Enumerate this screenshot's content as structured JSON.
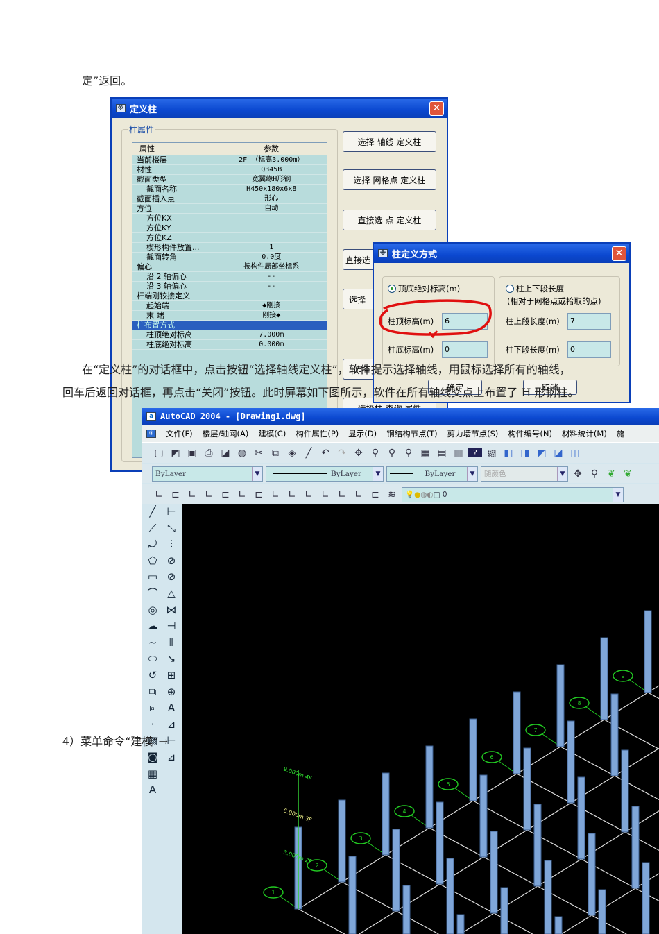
{
  "doc": {
    "line_top": "定”返回。",
    "para_line1": "在“定义柱”的对话框中，点击按钮“选择轴线定义柱”，软件提示选择轴线，用鼠标选择所有的轴线，",
    "para_line2": "回车后返回对话框，再点击“关闭”按钮。此时屏幕如下图所示，软件在所有轴线交点上布置了 H 形钢柱。",
    "step4": "4）菜单命令“建模”→"
  },
  "define_column_dialog": {
    "title": "定义柱",
    "group_label": "柱属性",
    "col_headers": [
      "属性",
      "参数"
    ],
    "rows": [
      {
        "name": "当前楼层",
        "value": "2F （标高3.000m）",
        "indent": 0
      },
      {
        "name": "材性",
        "value": "Q345B",
        "indent": 0
      },
      {
        "name": "截面类型",
        "value": "宽翼缘H形钢",
        "indent": 0
      },
      {
        "name": "截面名称",
        "value": "H450x180x6x8",
        "indent": 1
      },
      {
        "name": "截面插入点",
        "value": "形心",
        "indent": 0
      },
      {
        "name": "方位",
        "value": "自动",
        "indent": 0
      },
      {
        "name": "方位KX",
        "value": "",
        "indent": 1
      },
      {
        "name": "方位KY",
        "value": "",
        "indent": 1
      },
      {
        "name": "方位KZ",
        "value": "",
        "indent": 1
      },
      {
        "name": "楔形构件放置...",
        "value": "1",
        "indent": 1
      },
      {
        "name": "截面转角",
        "value": "0.0度",
        "indent": 1
      },
      {
        "name": "偏心",
        "value": "按构件局部坐标系",
        "indent": 0
      },
      {
        "name": "沿 2 轴偏心",
        "value": "--",
        "indent": 1
      },
      {
        "name": "沿 3 轴偏心",
        "value": "--",
        "indent": 1
      },
      {
        "name": "杆端刚铰接定义",
        "value": "",
        "indent": 0
      },
      {
        "name": "起始端",
        "value": "◆刚接",
        "indent": 1
      },
      {
        "name": "末  端",
        "value": "刚接◆",
        "indent": 1
      },
      {
        "name": "柱布置方式",
        "value": "",
        "indent": 0,
        "highlight": true
      },
      {
        "name": "柱顶绝对标高",
        "value": "7.000m",
        "indent": 1
      },
      {
        "name": "柱底绝对标高",
        "value": "0.000m",
        "indent": 1
      }
    ],
    "buttons": [
      "选择 轴线 定义柱",
      "选择 网格点 定义柱",
      "直接选 点 定义柱",
      "直接选",
      "选择",
      "选择",
      "选择柱 查询 属性"
    ]
  },
  "column_method_dialog": {
    "title": "柱定义方式",
    "radio_absolute": "顶底绝对标高(m)",
    "radio_length": "柱上下段长度",
    "radio_length_note": "(相对于网格点或拾取的点)",
    "top_elev_label": "柱顶标高(m)",
    "top_elev_value": "6",
    "bottom_elev_label": "柱底标高(m)",
    "bottom_elev_value": "0",
    "upper_len_label": "柱上段长度(m)",
    "upper_len_value": "7",
    "lower_len_label": "柱下段长度(m)",
    "lower_len_value": "0",
    "ok": "确定",
    "cancel": "取消",
    "annotation_color": "#e01010"
  },
  "autocad": {
    "title": "AutoCAD 2004 - [Drawing1.dwg]",
    "menu": [
      "文件(F)",
      "楼层/轴网(A)",
      "建模(C)",
      "构件属性(P)",
      "显示(D)",
      "钢结构节点(T)",
      "剪力墙节点(S)",
      "构件编号(N)",
      "材料统计(M)",
      "施"
    ],
    "layer_combo": "ByLayer",
    "linetype_combo": "ByLayer",
    "lineweight_combo": "ByLayer",
    "color_combo": "随颜色",
    "layer_name": "0",
    "axis_bubbles": [
      "1",
      "2",
      "3",
      "4",
      "5",
      "6",
      "7",
      "8",
      "9"
    ],
    "elev_labels": [
      "9.000m 4F",
      "6.000m 3F",
      "3.000m 2F"
    ],
    "column_color": "#7fa6d8"
  }
}
